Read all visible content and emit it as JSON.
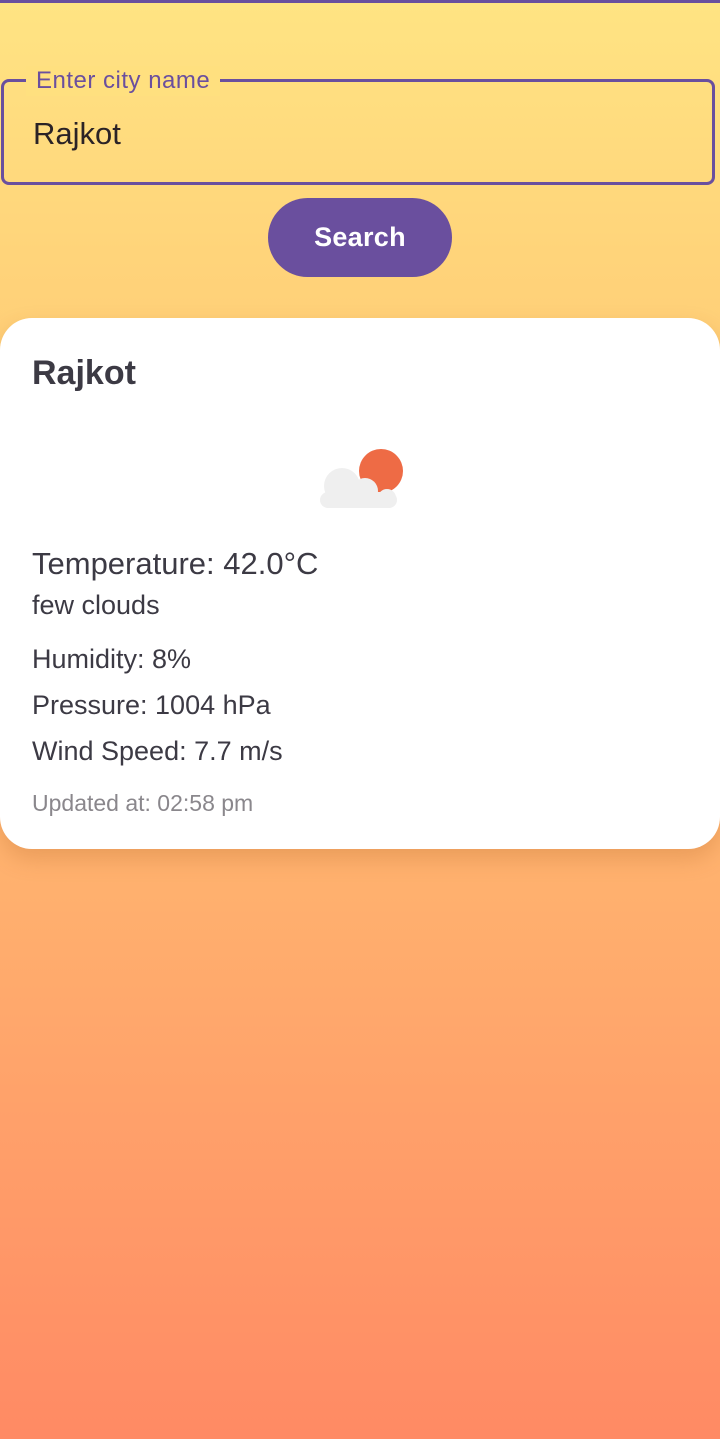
{
  "search": {
    "label": "Enter city name",
    "value": "Rajkot",
    "button_label": "Search"
  },
  "weather": {
    "city": "Rajkot",
    "icon": "few-clouds-day-icon",
    "temperature": "Temperature: 42.0°C",
    "description": "few clouds",
    "humidity": "Humidity: 8%",
    "pressure": "Pressure: 1004 hPa",
    "wind_speed": "Wind Speed: 7.7 m/s",
    "updated_at": "Updated at: 02:58 pm"
  },
  "colors": {
    "accent": "#6A4F9E",
    "gradient_top": "#FFE483",
    "gradient_bottom": "#FF8A64",
    "card": "#FFFFFF",
    "sun": "#EE6B45",
    "cloud": "#EFEFEF"
  }
}
